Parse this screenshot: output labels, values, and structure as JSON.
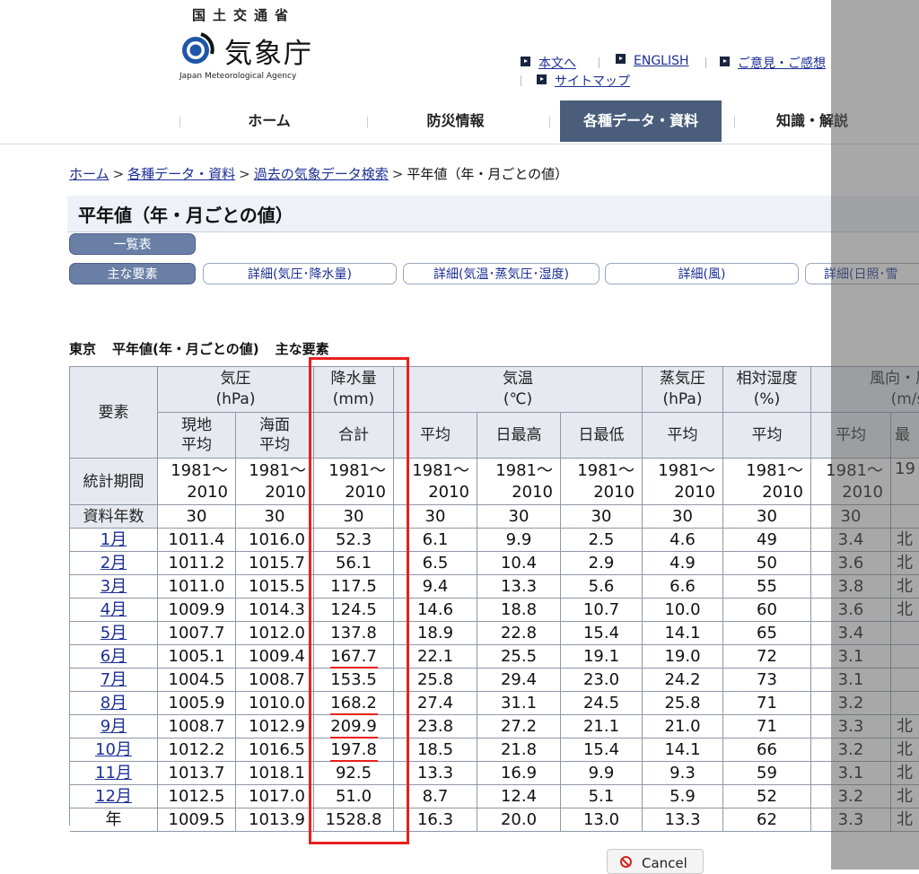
{
  "header": {
    "ministry": "国土交通省",
    "agency": "気象庁",
    "agency_en": "Japan Meteorological Agency",
    "links": {
      "main": "本文へ",
      "english": "ENGLISH",
      "feedback": "ご意見・ご感想",
      "sitemap": "サイトマップ"
    },
    "nav": [
      "ホーム",
      "防災情報",
      "各種データ・資料",
      "知識・解説"
    ]
  },
  "breadcrumb": [
    "ホーム",
    "各種データ・資料",
    "過去の気象データ検索",
    "平年値（年・月ごとの値）"
  ],
  "page_title": "平年値（年・月ごとの値）",
  "buttons": {
    "list": "一覧表",
    "main_elements": "主な要素",
    "detail_pressure": "詳細(気圧･降水量)",
    "detail_temp": "詳細(気温･蒸気圧･湿度)",
    "detail_wind": "詳細(風)",
    "detail_sun": "詳細(日照･雪"
  },
  "caption": {
    "station": "東京",
    "kind": "平年値(年・月ごとの値)",
    "element": "主な要素"
  },
  "table": {
    "h_element": "要素",
    "h_pressure": "気圧\n(hPa)",
    "h_precip": "降水量\n(mm)",
    "h_temp": "気温\n(℃)",
    "h_vapor": "蒸気圧\n(hPa)",
    "h_humidity": "相対湿度\n(%)",
    "h_wind": "風向・風\n(m/s)",
    "sub": [
      "現地\n平均",
      "海面\n平均",
      "合計",
      "平均",
      "日最高",
      "日最低",
      "平均",
      "平均",
      "平均",
      "最"
    ],
    "period_label": "統計期間",
    "period_value": "1981～\n2010",
    "period_last": "19",
    "years_label": "資料年数",
    "years": [
      "30",
      "30",
      "30",
      "30",
      "30",
      "30",
      "30",
      "30",
      "30",
      ""
    ],
    "rows": [
      {
        "m": "1月",
        "v": [
          "1011.4",
          "1016.0",
          "52.3",
          "6.1",
          "9.9",
          "2.5",
          "4.6",
          "49",
          "3.4",
          "北"
        ]
      },
      {
        "m": "2月",
        "v": [
          "1011.2",
          "1015.7",
          "56.1",
          "6.5",
          "10.4",
          "2.9",
          "4.9",
          "50",
          "3.6",
          "北"
        ]
      },
      {
        "m": "3月",
        "v": [
          "1011.0",
          "1015.5",
          "117.5",
          "9.4",
          "13.3",
          "5.6",
          "6.6",
          "55",
          "3.8",
          "北"
        ]
      },
      {
        "m": "4月",
        "v": [
          "1009.9",
          "1014.3",
          "124.5",
          "14.6",
          "18.8",
          "10.7",
          "10.0",
          "60",
          "3.6",
          "北"
        ]
      },
      {
        "m": "5月",
        "v": [
          "1007.7",
          "1012.0",
          "137.8",
          "18.9",
          "22.8",
          "15.4",
          "14.1",
          "65",
          "3.4",
          ""
        ]
      },
      {
        "m": "6月",
        "v": [
          "1005.1",
          "1009.4",
          "167.7",
          "22.1",
          "25.5",
          "19.1",
          "19.0",
          "72",
          "3.1",
          ""
        ]
      },
      {
        "m": "7月",
        "v": [
          "1004.5",
          "1008.7",
          "153.5",
          "25.8",
          "29.4",
          "23.0",
          "24.2",
          "73",
          "3.1",
          ""
        ]
      },
      {
        "m": "8月",
        "v": [
          "1005.9",
          "1010.0",
          "168.2",
          "27.4",
          "31.1",
          "24.5",
          "25.8",
          "71",
          "3.2",
          ""
        ]
      },
      {
        "m": "9月",
        "v": [
          "1008.7",
          "1012.9",
          "209.9",
          "23.8",
          "27.2",
          "21.1",
          "21.0",
          "71",
          "3.3",
          "北"
        ]
      },
      {
        "m": "10月",
        "v": [
          "1012.2",
          "1016.5",
          "197.8",
          "18.5",
          "21.8",
          "15.4",
          "14.1",
          "66",
          "3.2",
          "北"
        ]
      },
      {
        "m": "11月",
        "v": [
          "1013.7",
          "1018.1",
          "92.5",
          "13.3",
          "16.9",
          "9.9",
          "9.3",
          "59",
          "3.1",
          "北"
        ]
      },
      {
        "m": "12月",
        "v": [
          "1012.5",
          "1017.0",
          "51.0",
          "8.7",
          "12.4",
          "5.1",
          "5.9",
          "52",
          "3.2",
          "北"
        ]
      },
      {
        "m": "年",
        "v": [
          "1009.5",
          "1013.9",
          "1528.8",
          "16.3",
          "20.0",
          "13.0",
          "13.3",
          "62",
          "3.3",
          "北"
        ]
      }
    ],
    "underlined_months": [
      "6月",
      "8月",
      "9月",
      "10月"
    ]
  },
  "dialog": {
    "cancel": "Cancel"
  },
  "colors": {
    "highlight": "#e8201e",
    "link": "#1c2f96",
    "nav_active": "#4a5d7b"
  }
}
